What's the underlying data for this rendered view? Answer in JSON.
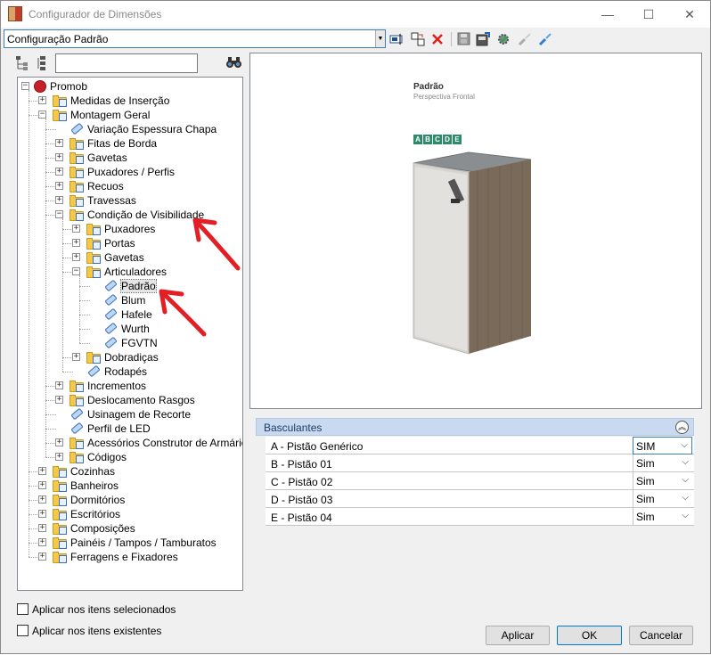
{
  "window": {
    "title": "Configurador de Dimensões",
    "controls": {
      "minimize": "—",
      "maximize": "☐",
      "close": "✕"
    }
  },
  "toolbar": {
    "config_value": "Configuração Padrão",
    "icons": [
      "rename-icon",
      "copy-icon",
      "delete-icon",
      "save-icon",
      "import-icon",
      "settings-icon",
      "link-icon",
      "unlink-icon"
    ]
  },
  "tree": {
    "search_value": "",
    "nodes": [
      {
        "label": "Promob",
        "depth": 0,
        "kind": "root",
        "expanded": true
      },
      {
        "label": "Medidas de Inserção",
        "depth": 1,
        "kind": "folder",
        "expanded": false
      },
      {
        "label": "Montagem Geral",
        "depth": 1,
        "kind": "folder",
        "expanded": true
      },
      {
        "label": "Variação Espessura Chapa",
        "depth": 2,
        "kind": "leaf"
      },
      {
        "label": "Fitas de Borda",
        "depth": 2,
        "kind": "folder",
        "expanded": false
      },
      {
        "label": "Gavetas",
        "depth": 2,
        "kind": "folder",
        "expanded": false
      },
      {
        "label": "Puxadores / Perfis",
        "depth": 2,
        "kind": "folder",
        "expanded": false
      },
      {
        "label": "Recuos",
        "depth": 2,
        "kind": "folder",
        "expanded": false
      },
      {
        "label": "Travessas",
        "depth": 2,
        "kind": "folder",
        "expanded": false
      },
      {
        "label": "Condição de Visibilidade",
        "depth": 2,
        "kind": "folder",
        "expanded": true
      },
      {
        "label": "Puxadores",
        "depth": 3,
        "kind": "folder",
        "expanded": false
      },
      {
        "label": "Portas",
        "depth": 3,
        "kind": "folder",
        "expanded": false
      },
      {
        "label": "Gavetas",
        "depth": 3,
        "kind": "folder",
        "expanded": false
      },
      {
        "label": "Articuladores",
        "depth": 3,
        "kind": "folder",
        "expanded": true
      },
      {
        "label": "Padrão",
        "depth": 4,
        "kind": "leaf",
        "selected": true
      },
      {
        "label": "Blum",
        "depth": 4,
        "kind": "leaf"
      },
      {
        "label": "Hafele",
        "depth": 4,
        "kind": "leaf"
      },
      {
        "label": "Wurth",
        "depth": 4,
        "kind": "leaf"
      },
      {
        "label": "FGVTN",
        "depth": 4,
        "kind": "leaf"
      },
      {
        "label": "Dobradiças",
        "depth": 3,
        "kind": "folder",
        "expanded": false
      },
      {
        "label": "Rodapés",
        "depth": 3,
        "kind": "leaf"
      },
      {
        "label": "Incrementos",
        "depth": 2,
        "kind": "folder",
        "expanded": false
      },
      {
        "label": "Deslocamento Rasgos",
        "depth": 2,
        "kind": "folder",
        "expanded": false
      },
      {
        "label": "Usinagem de Recorte",
        "depth": 2,
        "kind": "leaf"
      },
      {
        "label": "Perfil de LED",
        "depth": 2,
        "kind": "leaf"
      },
      {
        "label": "Acessórios Construtor de Armários",
        "depth": 2,
        "kind": "folder",
        "expanded": false
      },
      {
        "label": "Códigos",
        "depth": 2,
        "kind": "folder",
        "expanded": false
      },
      {
        "label": "Cozinhas",
        "depth": 1,
        "kind": "folder",
        "expanded": false
      },
      {
        "label": "Banheiros",
        "depth": 1,
        "kind": "folder",
        "expanded": false
      },
      {
        "label": "Dormitórios",
        "depth": 1,
        "kind": "folder",
        "expanded": false
      },
      {
        "label": "Escritórios",
        "depth": 1,
        "kind": "folder",
        "expanded": false
      },
      {
        "label": "Composições",
        "depth": 1,
        "kind": "folder",
        "expanded": false
      },
      {
        "label": "Painéis / Tampos / Tamburatos",
        "depth": 1,
        "kind": "folder",
        "expanded": false
      },
      {
        "label": "Ferragens e Fixadores",
        "depth": 1,
        "kind": "folder",
        "expanded": false
      }
    ]
  },
  "options": {
    "apply_selected": "Aplicar nos itens selecionados",
    "apply_existing": "Aplicar nos itens existentes"
  },
  "preview": {
    "title": "Padrão",
    "subtitle": "Perspectiva Frontal",
    "letters": [
      "A",
      "B",
      "C",
      "D",
      "E"
    ],
    "annotation_color": "#e31e24"
  },
  "properties": {
    "group": "Basculantes",
    "rows": [
      {
        "name": "A - Pistão Genérico",
        "value": "SIM"
      },
      {
        "name": "B - Pistão 01",
        "value": "Sim"
      },
      {
        "name": "C - Pistão 02",
        "value": "Sim"
      },
      {
        "name": "D - Pistão 03",
        "value": "Sim"
      },
      {
        "name": "E - Pistão 04",
        "value": "Sim"
      }
    ]
  },
  "buttons": {
    "apply": "Aplicar",
    "ok": "OK",
    "cancel": "Cancelar"
  }
}
